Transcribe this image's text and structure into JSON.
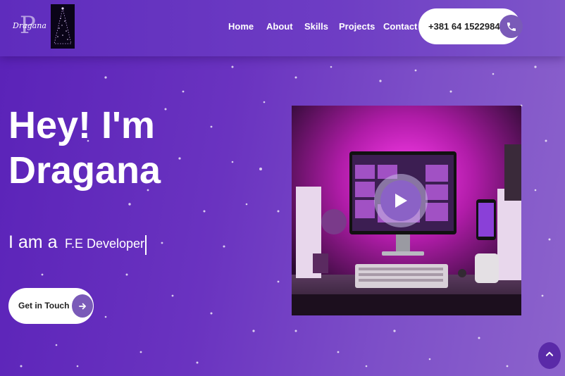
{
  "brand": {
    "logo_letter": "P",
    "logo_script": "Dragana"
  },
  "nav": {
    "items": [
      {
        "label": "Home"
      },
      {
        "label": "About"
      },
      {
        "label": "Skills"
      },
      {
        "label": "Projects"
      },
      {
        "label": "Contact"
      }
    ],
    "phone": "+381 64 1522984",
    "phone_icon": "phone-icon"
  },
  "hero": {
    "title_line1": "Hey! I'm",
    "title_line2": "Dragana",
    "typed_prefix": "I am a",
    "typed_text": "F.E Developer",
    "cta_label": "Get in Touch",
    "cta_icon": "arrow-right-icon",
    "image_icon": "play-icon"
  },
  "back_to_top_icon": "chevron-up-icon",
  "colors": {
    "accent": "#7a5ab8",
    "background": "#6a33c0",
    "white": "#ffffff"
  }
}
